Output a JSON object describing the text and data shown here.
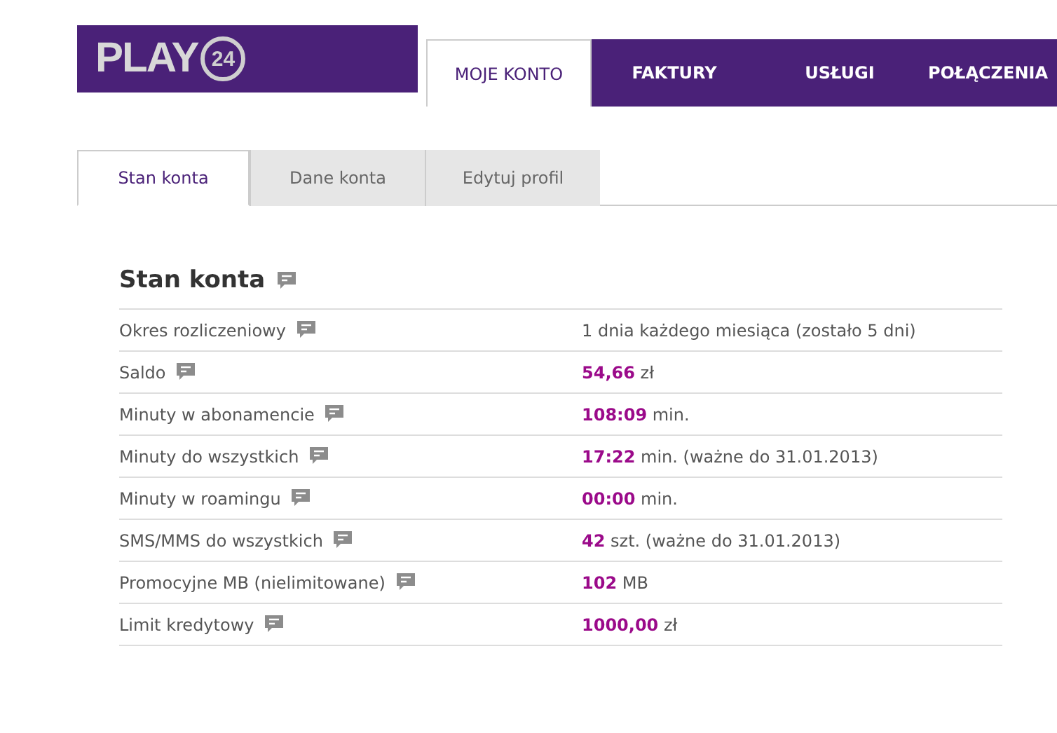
{
  "logo": {
    "text": "PLAY",
    "badge": "24"
  },
  "nav": [
    {
      "label": "MOJE KONTO",
      "selected": true
    },
    {
      "label": "FAKTURY",
      "selected": false
    },
    {
      "label": "USŁUGI",
      "selected": false
    },
    {
      "label": "POŁĄCZENIA",
      "selected": false
    }
  ],
  "tabs": [
    {
      "label": "Stan konta",
      "selected": true
    },
    {
      "label": "Dane konta",
      "selected": false
    },
    {
      "label": "Edytuj profil",
      "selected": false
    }
  ],
  "section": {
    "title": "Stan konta"
  },
  "rows": [
    {
      "label": "Okres rozliczeniowy",
      "value": "1 dnia każdego miesiąca (zostało 5 dni)"
    },
    {
      "label": "Saldo",
      "value": "**54,66** zł"
    },
    {
      "label": "Minuty w abonamencie",
      "value": "**108:09** min."
    },
    {
      "label": "Minuty do wszystkich",
      "value": "**17:22** min. (ważne do 31.01.2013)"
    },
    {
      "label": "Minuty w roamingu",
      "value": "**00:00** min."
    },
    {
      "label": "SMS/MMS do wszystkich",
      "value": "**42** szt. (ważne do 31.01.2013)"
    },
    {
      "label": "Promocyjne MB (nielimitowane)",
      "value": "**102** MB"
    },
    {
      "label": "Limit kredytowy",
      "value": "**1000,00** zł"
    }
  ]
}
